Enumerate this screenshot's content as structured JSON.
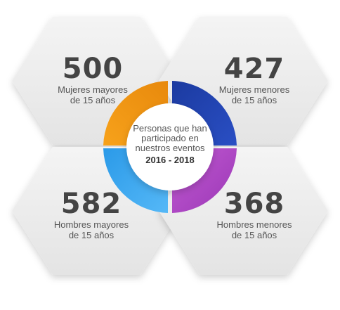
{
  "center": {
    "line1": "Personas que han",
    "line2": "participado en",
    "line3": "nuestros eventos",
    "years": "2016 - 2018"
  },
  "stats": {
    "top_left": {
      "number": "500",
      "label1": "Mujeres mayores",
      "label2": "de 15 años",
      "color": "#f39c12"
    },
    "top_right": {
      "number": "427",
      "label1": "Mujeres menores",
      "label2": "de 15 años",
      "color": "#1e3fa8"
    },
    "bottom_left": {
      "number": "582",
      "label1": "Hombres mayores",
      "label2": "de 15 años",
      "color": "#3fa9f5"
    },
    "bottom_right": {
      "number": "368",
      "label1": "Hombres menores",
      "label2": "de 15 años",
      "color": "#b048c6"
    }
  }
}
